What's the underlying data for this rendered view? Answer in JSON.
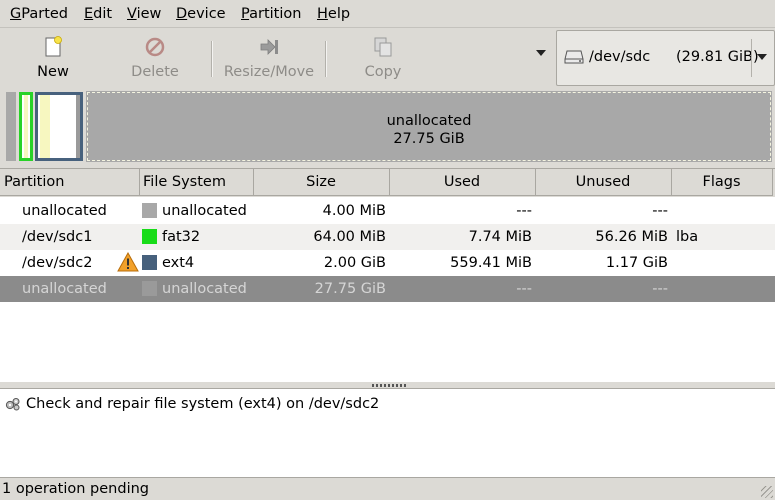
{
  "menu": [
    {
      "mnemonic": "G",
      "rest": "Parted"
    },
    {
      "mnemonic": "E",
      "rest": "dit"
    },
    {
      "mnemonic": "V",
      "rest": "iew"
    },
    {
      "mnemonic": "D",
      "rest": "evice"
    },
    {
      "mnemonic": "P",
      "rest": "artition"
    },
    {
      "mnemonic": "H",
      "rest": "elp"
    }
  ],
  "toolbar": {
    "new_label": "New",
    "delete_label": "Delete",
    "resize_label": "Resize/Move",
    "copy_label": "Copy"
  },
  "device": {
    "name": "/dev/sdc",
    "size": "(29.81 GiB)"
  },
  "disk_map": {
    "unallocated_label": "unallocated",
    "unallocated_size": "27.75 GiB"
  },
  "columns": {
    "partition": "Partition",
    "filesystem": "File System",
    "size": "Size",
    "used": "Used",
    "unused": "Unused",
    "flags": "Flags"
  },
  "partitions": [
    {
      "partition": "unallocated",
      "filesystem": "unallocated",
      "fs_color": "#a8a8a8",
      "size": "4.00 MiB",
      "used": "---",
      "unused": "---",
      "flags": "",
      "warning": false
    },
    {
      "partition": "/dev/sdc1",
      "filesystem": "fat32",
      "fs_color": "#18dc18",
      "size": "64.00 MiB",
      "used": "7.74 MiB",
      "unused": "56.26 MiB",
      "flags": "lba",
      "warning": false
    },
    {
      "partition": "/dev/sdc2",
      "filesystem": "ext4",
      "fs_color": "#46607c",
      "size": "2.00 GiB",
      "used": "559.41 MiB",
      "unused": "1.17 GiB",
      "flags": "",
      "warning": true
    },
    {
      "partition": "unallocated",
      "filesystem": "unallocated",
      "fs_color": "#a8a8a8",
      "size": "27.75 GiB",
      "used": "---",
      "unused": "---",
      "flags": "",
      "warning": false
    }
  ],
  "operations": [
    {
      "text": "Check and repair file system (ext4) on /dev/sdc2",
      "icon": "check-repair-icon"
    }
  ],
  "status": {
    "text": "1 operation pending"
  }
}
